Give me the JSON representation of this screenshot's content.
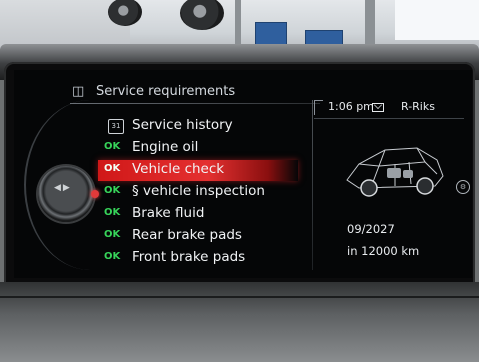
{
  "header": {
    "icon": "car-service-icon",
    "title": "Service requirements"
  },
  "status_bar": {
    "time": "1:06 pm",
    "radio": "R-Riks"
  },
  "menu": {
    "items": [
      {
        "status": "",
        "icon": "service-history-icon",
        "label": "Service history",
        "selected": false
      },
      {
        "status": "OK",
        "label": "Engine oil",
        "selected": false
      },
      {
        "status": "OK",
        "label": "Vehicle check",
        "selected": true
      },
      {
        "status": "OK",
        "label": "§ vehicle inspection",
        "selected": false
      },
      {
        "status": "OK",
        "label": "Brake fluid",
        "selected": false
      },
      {
        "status": "OK",
        "label": "Rear brake pads",
        "selected": false
      },
      {
        "status": "OK",
        "label": "Front brake pads",
        "selected": false
      }
    ]
  },
  "details": {
    "due_date": "09/2027",
    "due_distance": "in 12000 km"
  },
  "colors": {
    "ok": "#37d45a",
    "selection": "#d01818",
    "text": "#f1f3f5"
  }
}
